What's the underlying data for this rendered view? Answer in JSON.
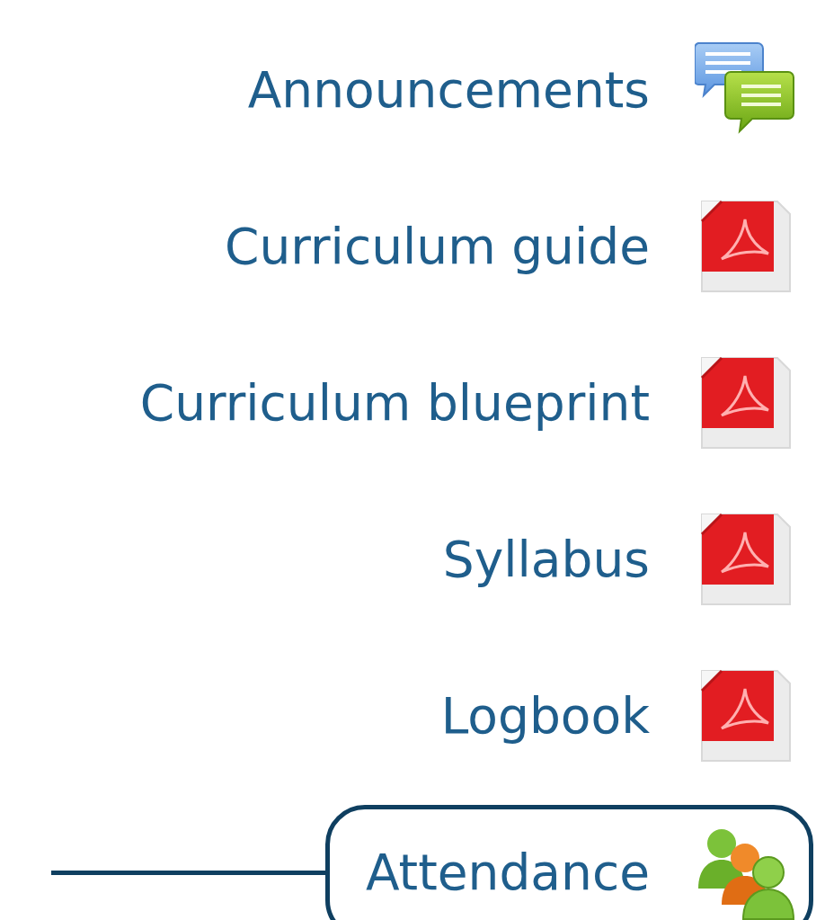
{
  "items": [
    {
      "label": "Announcements",
      "kind": "forum",
      "highlighted": false
    },
    {
      "label": "Curriculum guide",
      "kind": "pdf",
      "highlighted": false
    },
    {
      "label": "Curriculum blueprint",
      "kind": "pdf",
      "highlighted": false
    },
    {
      "label": "Syllabus",
      "kind": "pdf",
      "highlighted": false
    },
    {
      "label": "Logbook",
      "kind": "pdf",
      "highlighted": false
    },
    {
      "label": "Attendance",
      "kind": "attendance",
      "highlighted": true
    }
  ]
}
